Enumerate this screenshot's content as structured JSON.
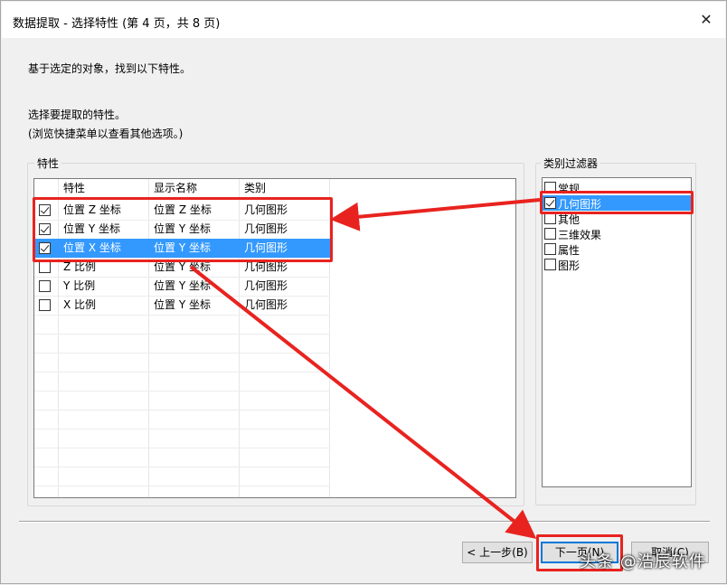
{
  "window": {
    "title": "数据提取 - 选择特性 (第 4 页，共 8 页)",
    "close_glyph": "✕"
  },
  "intro_text": "基于选定的对象，找到以下特性。",
  "instruction_line1": "选择要提取的特性。",
  "instruction_line2": "(浏览快捷菜单以查看其他选项。)",
  "properties_group": {
    "label": "特性",
    "columns": [
      "特性",
      "显示名称",
      "类别"
    ],
    "rows": [
      {
        "checked": true,
        "name": "位置 Z 坐标",
        "display": "位置 Z 坐标",
        "category": "几何图形",
        "selected": false
      },
      {
        "checked": true,
        "name": "位置 Y 坐标",
        "display": "位置 Y 坐标",
        "category": "几何图形",
        "selected": false
      },
      {
        "checked": true,
        "name": "位置 X 坐标",
        "display": "位置 Y 坐标",
        "category": "几何图形",
        "selected": true
      },
      {
        "checked": false,
        "name": "Z 比例",
        "display": "位置 Y 坐标",
        "category": "几何图形",
        "selected": false
      },
      {
        "checked": false,
        "name": "Y 比例",
        "display": "位置 Y 坐标",
        "category": "几何图形",
        "selected": false
      },
      {
        "checked": false,
        "name": "X 比例",
        "display": "位置 Y 坐标",
        "category": "几何图形",
        "selected": false
      }
    ]
  },
  "filter_group": {
    "label": "类别过滤器",
    "items": [
      {
        "label": "常规",
        "checked": false,
        "selected": false
      },
      {
        "label": "几何图形",
        "checked": true,
        "selected": true
      },
      {
        "label": "其他",
        "checked": false,
        "selected": false
      },
      {
        "label": "三维效果",
        "checked": false,
        "selected": false
      },
      {
        "label": "属性",
        "checked": false,
        "selected": false
      },
      {
        "label": "图形",
        "checked": false,
        "selected": false
      }
    ]
  },
  "buttons": {
    "back": "< 上一步(B)",
    "next": "下一页(N)",
    "cancel": "取消(C)"
  },
  "watermark": "头条 @浩辰软件",
  "colors": {
    "selection": "#3399ff",
    "annotation_red": "#e8231f"
  }
}
